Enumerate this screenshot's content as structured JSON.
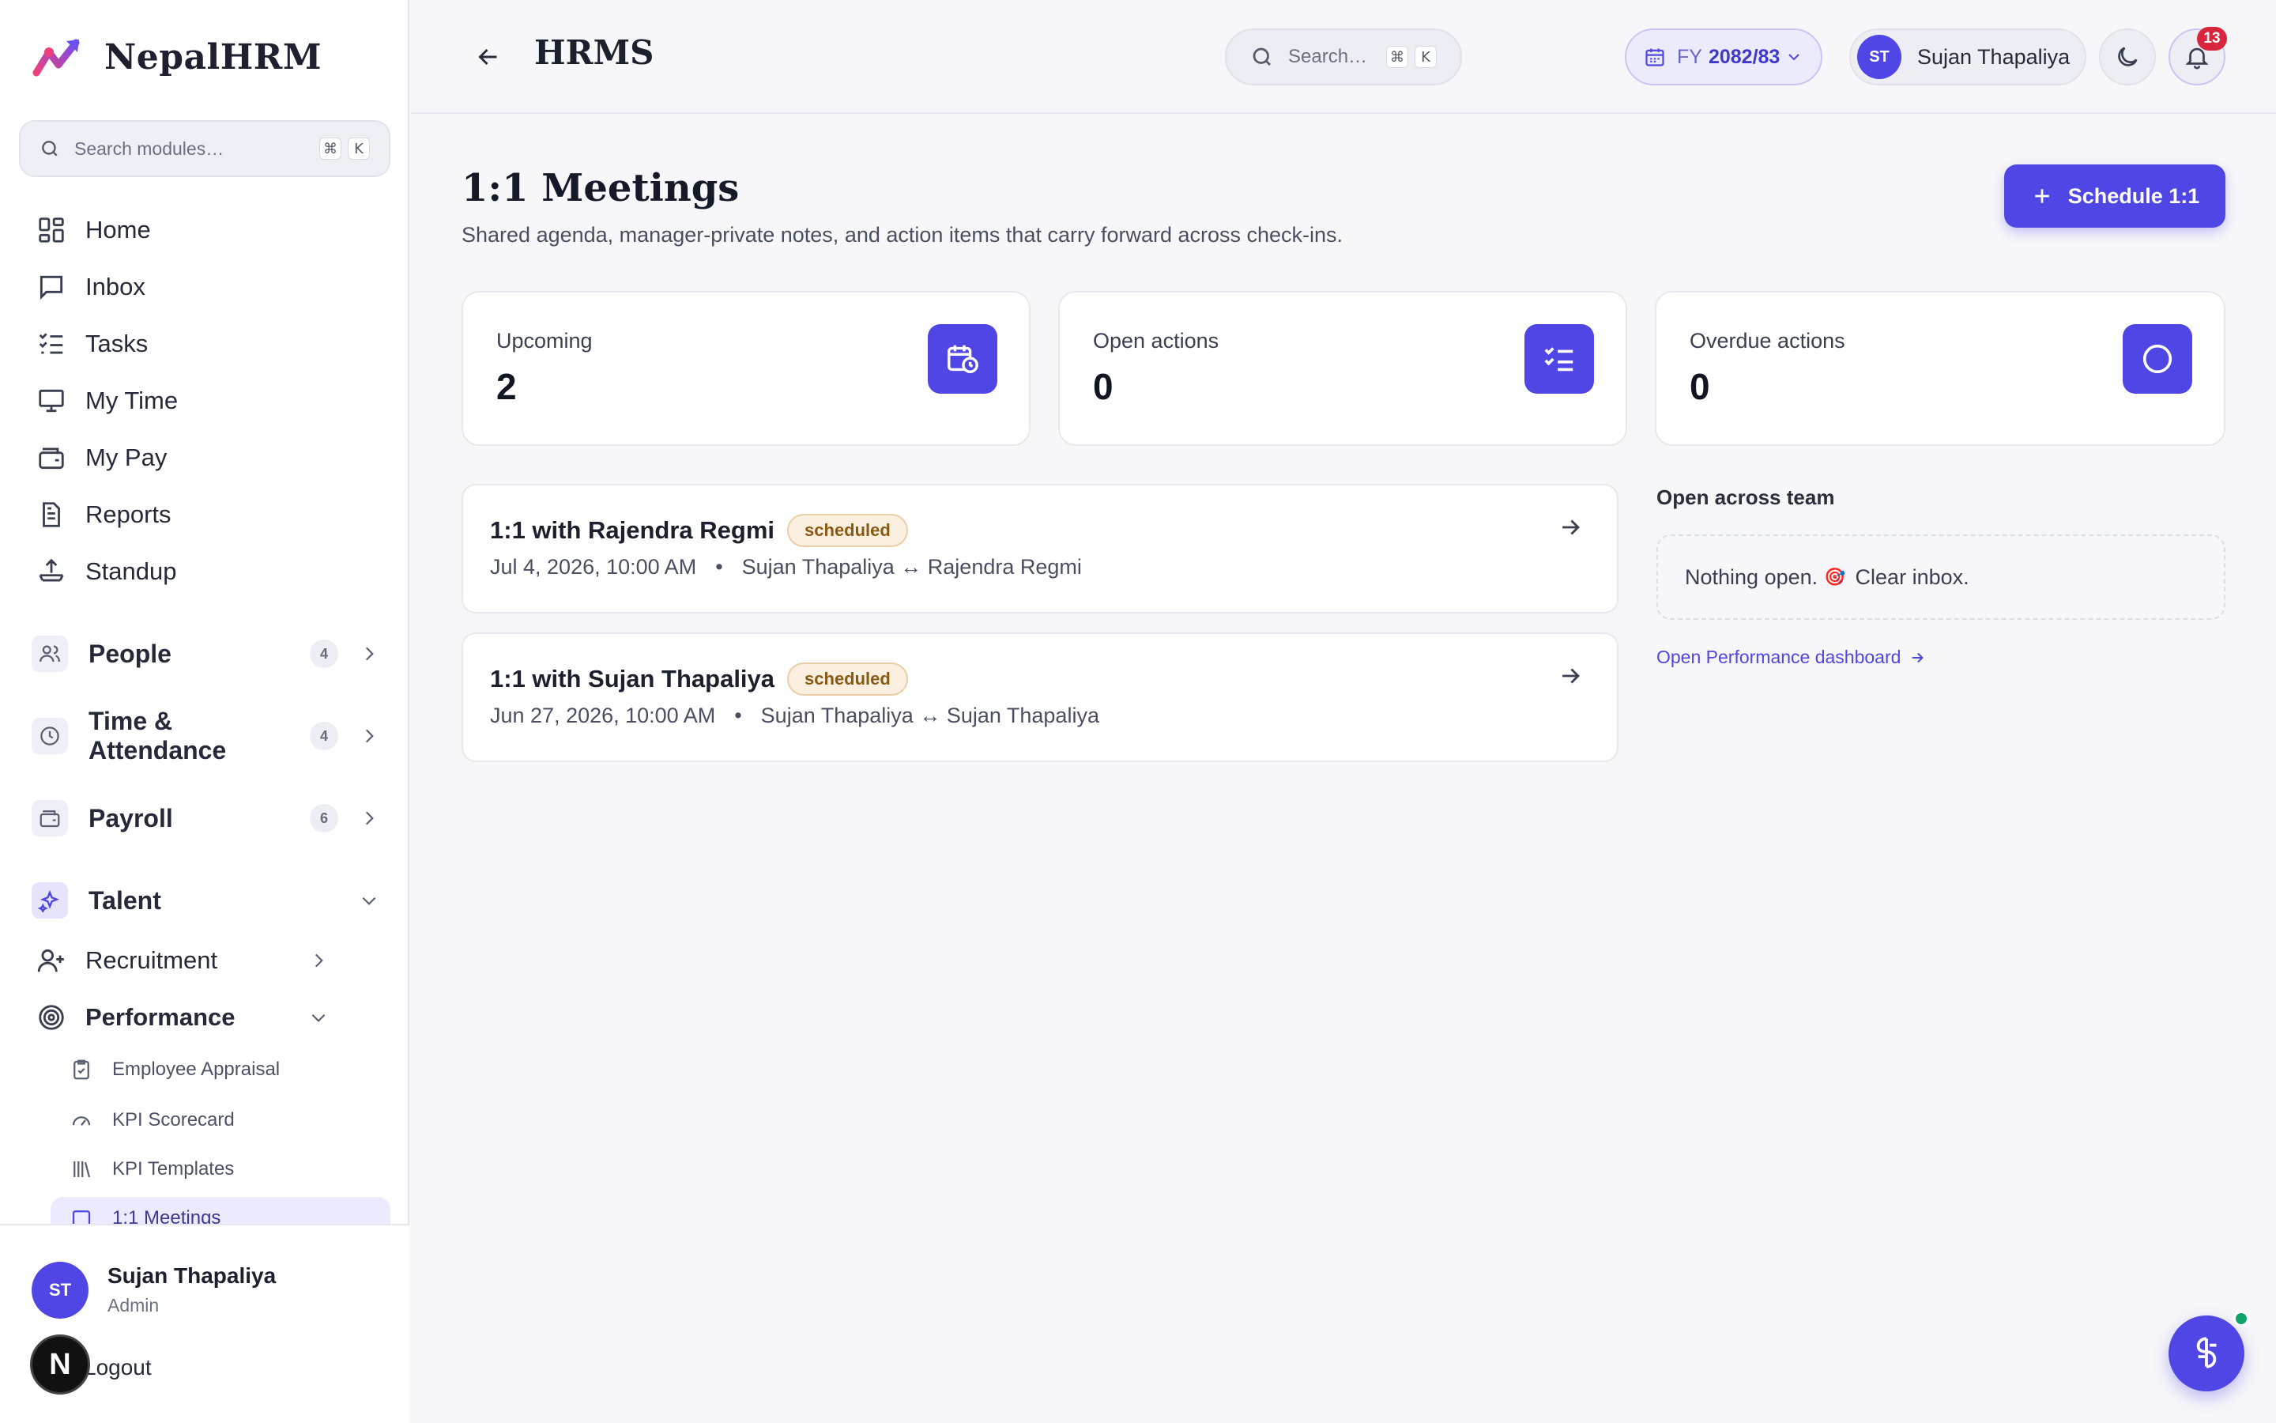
{
  "brand": {
    "name": "NepalHRM",
    "accent": "#4f46e5"
  },
  "sidebar": {
    "search_placeholder": "Search modules…",
    "shortcut": [
      "⌘",
      "K"
    ],
    "nav": [
      {
        "label": "Home",
        "icon": "grid-icon"
      },
      {
        "label": "Inbox",
        "icon": "message-icon"
      },
      {
        "label": "Tasks",
        "icon": "list-check-icon"
      },
      {
        "label": "My Time",
        "icon": "monitor-icon"
      },
      {
        "label": "My Pay",
        "icon": "wallet-icon"
      },
      {
        "label": "Reports",
        "icon": "document-icon"
      },
      {
        "label": "Standup",
        "icon": "standup-icon"
      }
    ],
    "groups": [
      {
        "label": "People",
        "count": "4"
      },
      {
        "label": "Time & Attendance",
        "count": "4"
      },
      {
        "label": "Payroll",
        "count": "6"
      },
      {
        "label": "Talent"
      }
    ],
    "talent_items": [
      {
        "label": "Recruitment"
      },
      {
        "label": "Performance"
      }
    ],
    "performance_items": [
      {
        "label": "Employee Appraisal"
      },
      {
        "label": "KPI Scorecard"
      },
      {
        "label": "KPI Templates"
      },
      {
        "label": "1:1 Meetings"
      }
    ],
    "user": {
      "initials": "ST",
      "name": "Sujan Thapaliya",
      "role": "Admin"
    },
    "logout": "Logout"
  },
  "topbar": {
    "title": "HRMS",
    "search_placeholder": "Search…",
    "shortcut": [
      "⌘",
      "K"
    ],
    "fy_prefix": "FY",
    "fy_value": "2082/83",
    "user_initials": "ST",
    "user_name": "Sujan Thapaliya",
    "notifications": "13"
  },
  "page": {
    "title": "1:1 Meetings",
    "subtitle": "Shared agenda, manager-private notes, and action items that carry forward across check-ins.",
    "schedule_button": "Schedule 1:1",
    "stats": [
      {
        "label": "Upcoming",
        "value": "2",
        "icon": "calendar-clock-icon"
      },
      {
        "label": "Open actions",
        "value": "0",
        "icon": "list-check-icon"
      },
      {
        "label": "Overdue actions",
        "value": "0",
        "icon": "circle-icon"
      }
    ],
    "meetings": [
      {
        "title": "1:1 with Rajendra Regmi",
        "status": "scheduled",
        "date": "Jul 4, 2026, 10:00 AM",
        "bullet": "•",
        "participants": "Sujan Thapaliya ↔ Rajendra Regmi"
      },
      {
        "title": "1:1 with Sujan Thapaliya",
        "status": "scheduled",
        "date": "Jun 27, 2026, 10:00 AM",
        "bullet": "•",
        "participants": "Sujan Thapaliya ↔ Sujan Thapaliya"
      }
    ],
    "team_panel": {
      "heading": "Open across team",
      "empty_text": "Nothing open.",
      "empty_emoji": "🎯",
      "empty_suffix": "Clear inbox.",
      "link": "Open Performance dashboard"
    }
  }
}
